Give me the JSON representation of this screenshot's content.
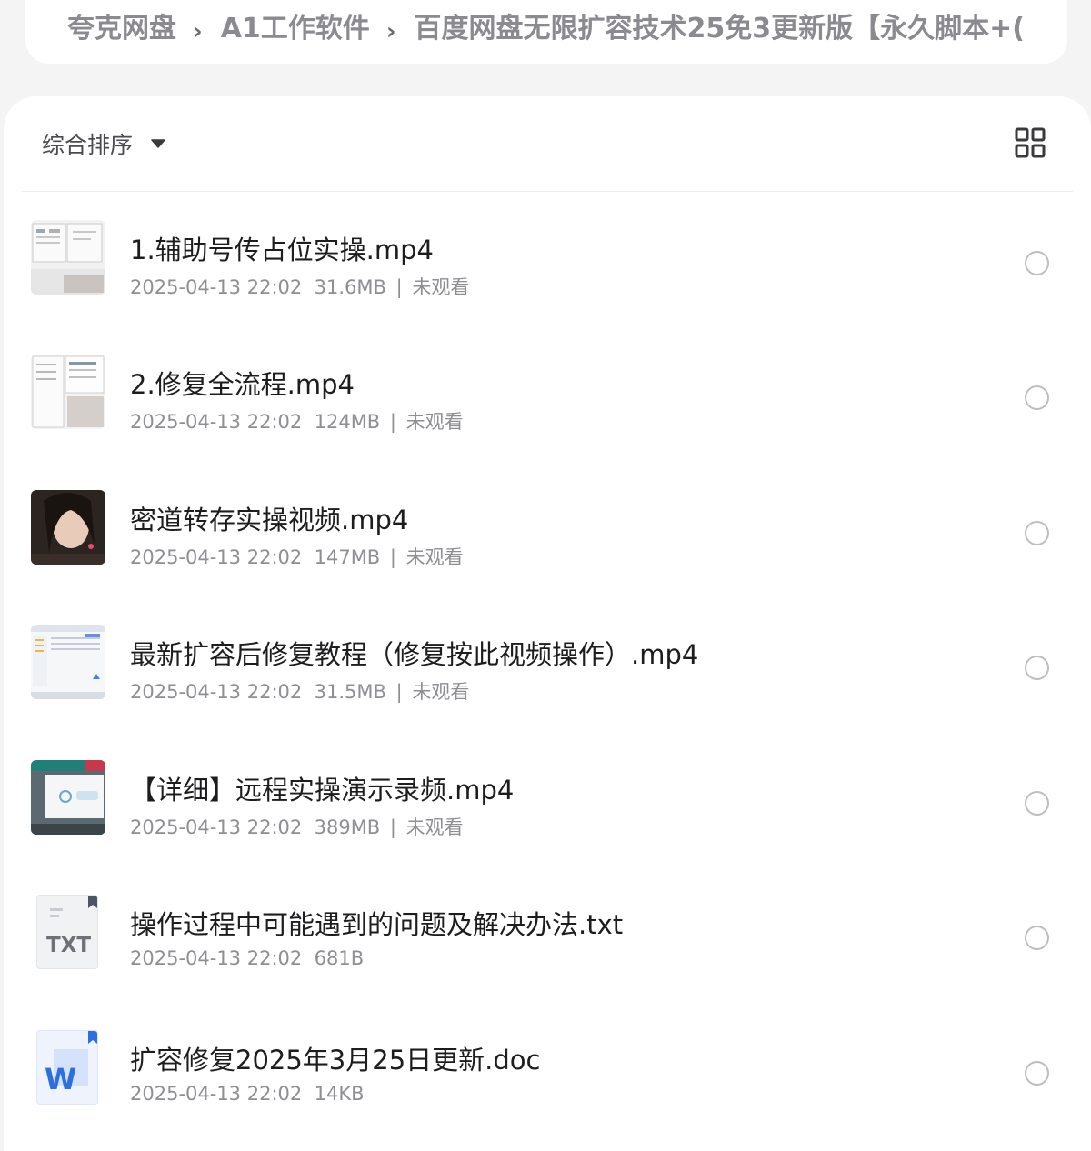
{
  "breadcrumb": {
    "items": [
      "夸克网盘",
      "A1工作软件",
      "百度网盘无限扩容技术25免3更新版【永久脚本+("
    ],
    "separator": "›"
  },
  "toolbar": {
    "sort_label": "综合排序",
    "sort_icon": "caret-down-icon",
    "view_icon": "grid-view-icon"
  },
  "files": [
    {
      "name": "1.辅助号传占位实操.mp4",
      "date": "2025-04-13 22:02",
      "size": "31.6MB",
      "watch_status": "未观看",
      "thumb": "video-screenshot"
    },
    {
      "name": "2.修复全流程.mp4",
      "date": "2025-04-13 22:02",
      "size": "124MB",
      "watch_status": "未观看",
      "thumb": "video-screenshot"
    },
    {
      "name": "密道转存实操视频.mp4",
      "date": "2025-04-13 22:02",
      "size": "147MB",
      "watch_status": "未观看",
      "thumb": "video-portrait"
    },
    {
      "name": "最新扩容后修复教程（修复按此视频操作）.mp4",
      "date": "2025-04-13 22:02",
      "size": "31.5MB",
      "watch_status": "未观看",
      "thumb": "video-screenshot"
    },
    {
      "name": "【详细】远程实操演示录频.mp4",
      "date": "2025-04-13 22:02",
      "size": "389MB",
      "watch_status": "未观看",
      "thumb": "video-screenshot"
    },
    {
      "name": "操作过程中可能遇到的问题及解决办法.txt",
      "date": "2025-04-13 22:02",
      "size": "681B",
      "watch_status": "",
      "thumb": "txt-file-icon",
      "badge": "TXT"
    },
    {
      "name": "扩容修复2025年3月25日更新.doc",
      "date": "2025-04-13 22:02",
      "size": "14KB",
      "watch_status": "",
      "thumb": "word-file-icon",
      "badge": "W"
    }
  ],
  "colors": {
    "accent_word": "#2b6fe0",
    "text_primary": "#1d1d1f",
    "text_secondary": "#8e8e93"
  }
}
